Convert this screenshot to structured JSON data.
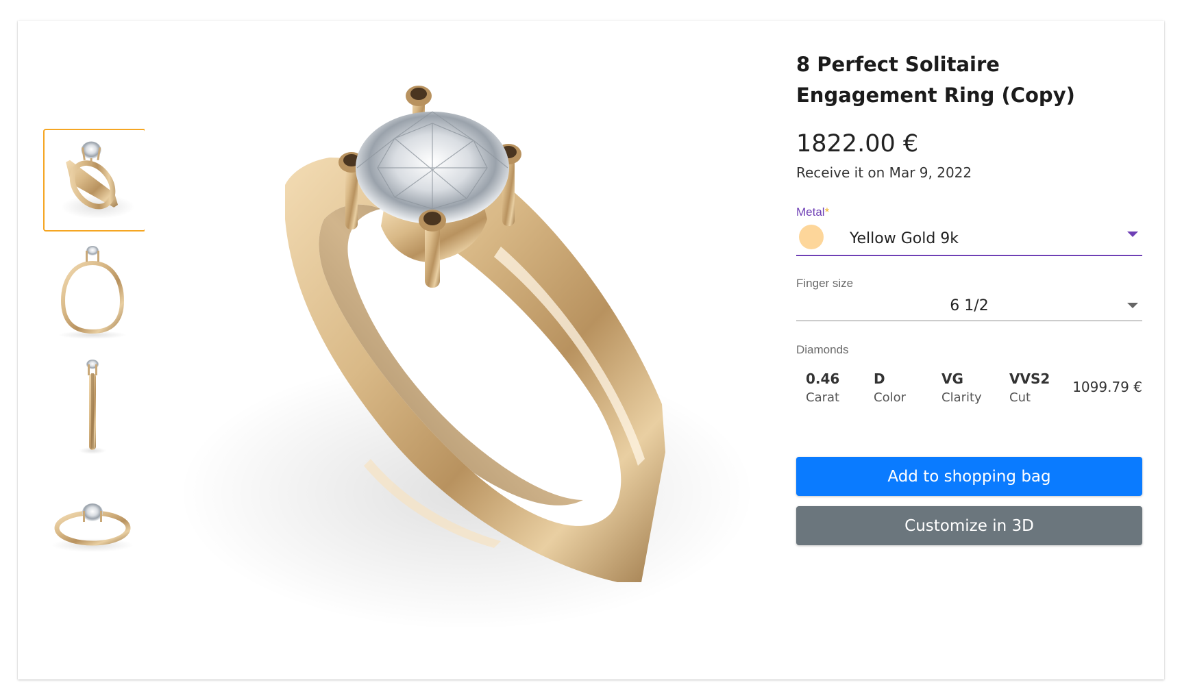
{
  "product": {
    "title": "8 Perfect Solitaire Engagement Ring (Copy)",
    "price": "1822.00 €",
    "delivery": "Receive it on Mar 9, 2022"
  },
  "gallery": {
    "thumbnails": [
      {
        "view": "perspective",
        "selected": true
      },
      {
        "view": "front"
      },
      {
        "view": "side"
      },
      {
        "view": "top-angle"
      }
    ],
    "accent_color": "#f5a623"
  },
  "metal": {
    "label": "Metal",
    "required_mark": "*",
    "value": "Yellow Gold 9k",
    "swatch_color": "#fdd69a",
    "accent_color": "#6e3fb5"
  },
  "finger_size": {
    "label": "Finger size",
    "value": "6 1/2"
  },
  "diamonds": {
    "label": "Diamonds",
    "carat": {
      "value": "0.46",
      "label": "Carat"
    },
    "color": {
      "value": "D",
      "label": "Color"
    },
    "clarity": {
      "value": "VG",
      "label": "Clarity"
    },
    "cut": {
      "value": "VVS2",
      "label": "Cut"
    },
    "price": "1099.79 €"
  },
  "actions": {
    "add_to_bag": "Add to shopping bag",
    "add_to_bag_color": "#0a7bff",
    "customize": "Customize in 3D",
    "customize_color": "#6b767d"
  }
}
